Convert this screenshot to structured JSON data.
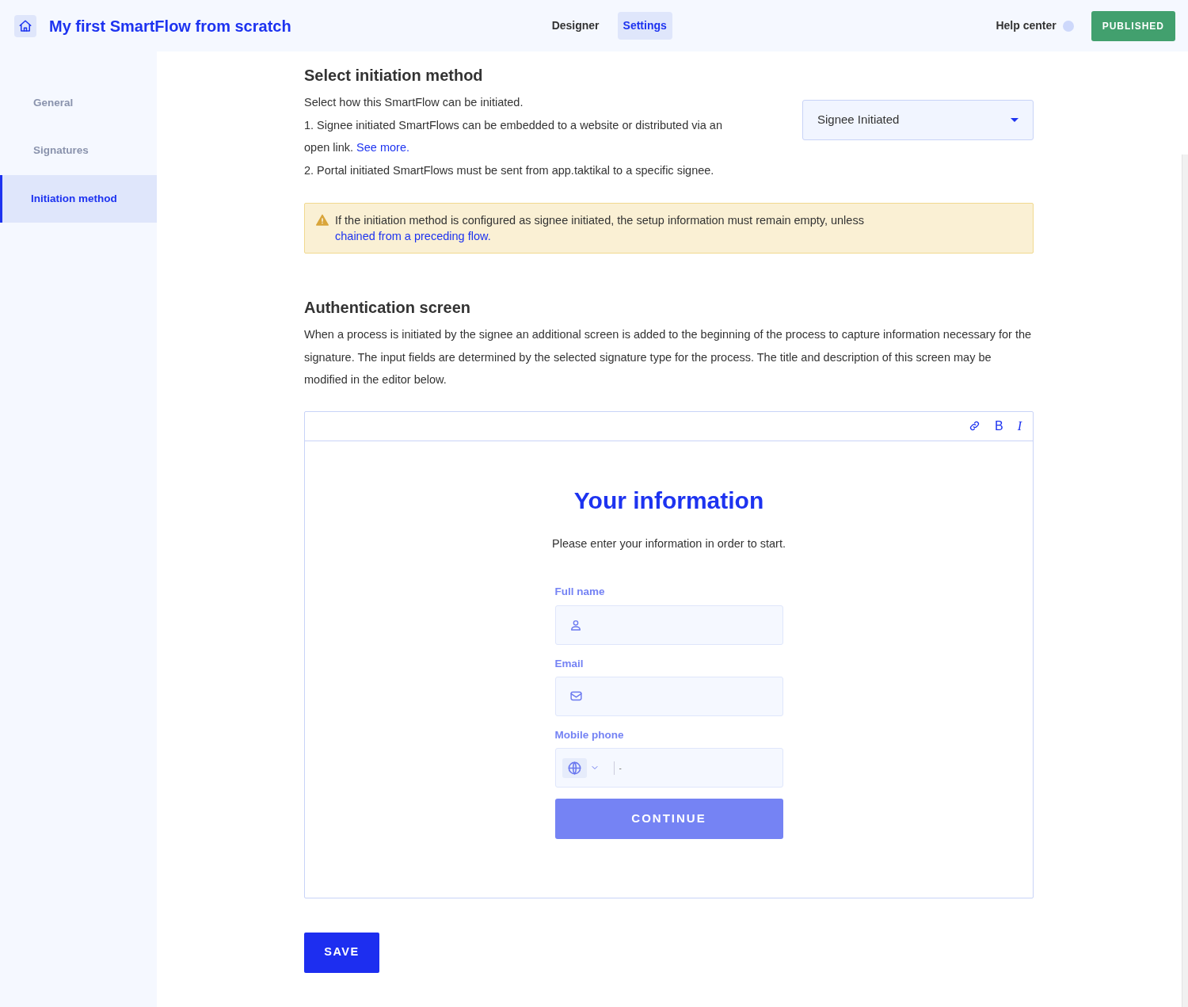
{
  "header": {
    "title": "My first SmartFlow from scratch",
    "tabs": [
      {
        "label": "Designer",
        "selected": false
      },
      {
        "label": "Settings",
        "selected": true
      }
    ],
    "help_label": "Help center",
    "status_button": "PUBLISHED"
  },
  "sidebar": {
    "items": [
      {
        "label": "General",
        "selected": false
      },
      {
        "label": "Signatures",
        "selected": false
      },
      {
        "label": "Initiation method",
        "selected": true
      }
    ]
  },
  "initiation": {
    "heading": "Select initiation method",
    "lines": [
      {
        "text": "Select how this SmartFlow can be initiated."
      },
      {
        "text": "1. Signee initiated SmartFlows can be embedded to a website or distributed via an open link.",
        "link": "See more."
      },
      {
        "text": "2. Portal initiated SmartFlows must be sent from app.taktikal to a specific signee."
      }
    ],
    "select_value": "Signee Initiated",
    "alert": {
      "text": "If the initiation method is configured as signee initiated, the setup information must remain empty, unless",
      "link": "chained from a preceding flow."
    }
  },
  "authentication": {
    "heading": "Authentication screen",
    "description": "When a process is initiated by the signee an additional screen is added to the beginning of the process to capture information necessary for the signature. The input fields are determined by the selected signature type for the process. The title and description of this screen may be modified in the editor below.",
    "toolbar": [
      {
        "kind": "link"
      },
      {
        "kind": "bold",
        "glyph": "B"
      },
      {
        "kind": "italic",
        "glyph": "I"
      }
    ],
    "preview": {
      "title": "Your information",
      "subtitle": "Please enter your information in order to start.",
      "fields": [
        {
          "kind": "person",
          "label": "Full name"
        },
        {
          "kind": "email",
          "label": "Email"
        },
        {
          "kind": "phone",
          "label": "Mobile phone",
          "placeholder": "-"
        }
      ],
      "button": "CONTINUE"
    }
  },
  "save_button": "SAVE"
}
